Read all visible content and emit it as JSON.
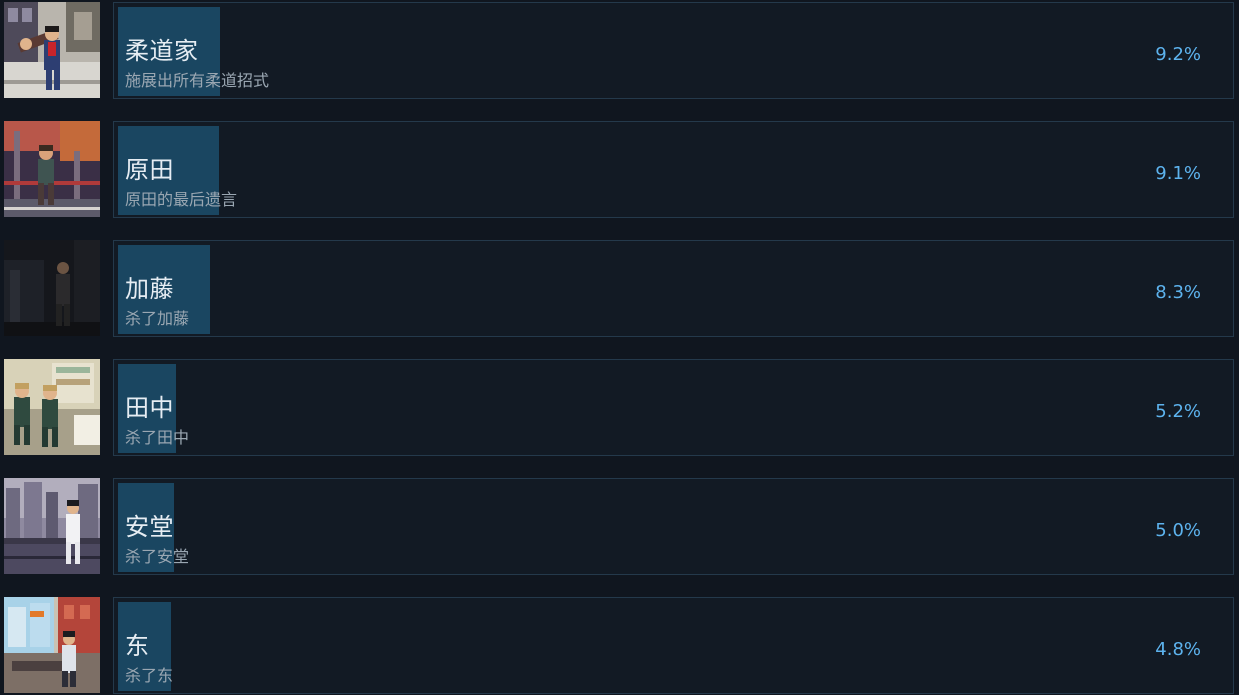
{
  "achievements": [
    {
      "title": "柔道家",
      "description": "施展出所有柔道招式",
      "percent_label": "9.2%",
      "percent": 9.2,
      "thumb_icon": "judo-throw-scene-icon"
    },
    {
      "title": "原田",
      "description": "原田的最后遗言",
      "percent_label": "9.1%",
      "percent": 9.1,
      "thumb_icon": "harada-scene-icon"
    },
    {
      "title": "加藤",
      "description": "杀了加藤",
      "percent_label": "8.3%",
      "percent": 8.3,
      "thumb_icon": "kato-dark-scene-icon"
    },
    {
      "title": "田中",
      "description": "杀了田中",
      "percent_label": "5.2%",
      "percent": 5.2,
      "thumb_icon": "tanaka-scene-icon"
    },
    {
      "title": "安堂",
      "description": "杀了安堂",
      "percent_label": "5.0%",
      "percent": 5.0,
      "thumb_icon": "ando-rooftop-scene-icon"
    },
    {
      "title": "东",
      "description": "杀了东",
      "percent_label": "4.8%",
      "percent": 4.8,
      "thumb_icon": "higashi-office-scene-icon"
    }
  ],
  "colors": {
    "background": "#10161f",
    "card": "#121a24",
    "card_border": "#24394b",
    "progress_fill": "#1a4661",
    "title": "#e6edf3",
    "description": "#9aa7b2",
    "percent": "#5db3ee"
  }
}
